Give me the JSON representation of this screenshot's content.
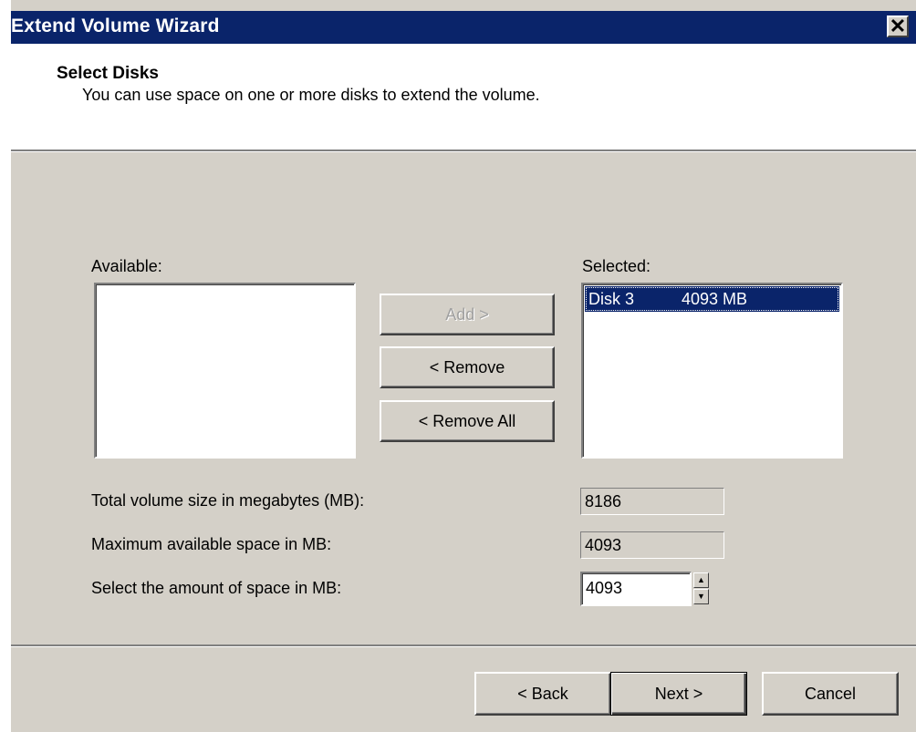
{
  "window": {
    "title": "Extend Volume Wizard",
    "close_glyph": "✕"
  },
  "header": {
    "title": "Select Disks",
    "subtitle": "You can use space on one or more disks to extend the volume."
  },
  "available": {
    "label": "Available:",
    "items": []
  },
  "selected": {
    "label": "Selected:",
    "items": [
      {
        "disk": "Disk 3",
        "size": "4093 MB"
      }
    ]
  },
  "buttons": {
    "add": "Add >",
    "remove": "< Remove",
    "remove_all": "< Remove All",
    "back": "< Back",
    "next": "Next >",
    "cancel": "Cancel"
  },
  "fields": {
    "total_label": "Total volume size in megabytes (MB):",
    "total_value": "8186",
    "max_label": "Maximum available space in MB:",
    "max_value": "4093",
    "amount_label": "Select the amount of space in MB:",
    "amount_value": "4093"
  },
  "icons": {
    "spin_up": "▲",
    "spin_down": "▼"
  },
  "colors": {
    "titlebar": "#0a246a",
    "dialog_face": "#d4d0c8",
    "selection": "#0a246a"
  }
}
